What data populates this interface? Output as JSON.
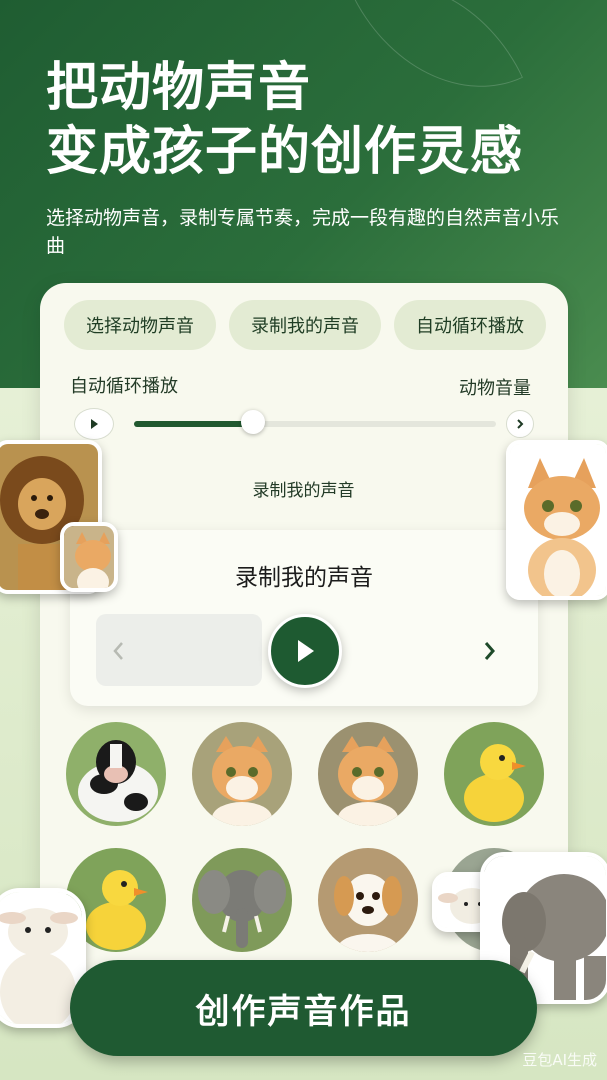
{
  "hero": {
    "title_line1": "把动物声音",
    "title_line2": "变成孩子的创作灵感",
    "subtitle": "选择动物声音，录制专属节奏，完成一段有趣的自然声音小乐曲"
  },
  "chips": [
    "选择动物声音",
    "录制我的声音",
    "自动循环播放"
  ],
  "controls": {
    "loop_label": "自动循环播放",
    "volume_label": "动物音量",
    "volume_level": 0.33,
    "record_caption": "录制我的声音"
  },
  "recorder": {
    "title": "录制我的声音",
    "play_icon": "play-icon",
    "prev_icon": "chevron-left-icon",
    "next_icon": "chevron-right-icon"
  },
  "animals": [
    "cow",
    "kitten",
    "kitten",
    "duckling",
    "duckling",
    "elephant",
    "puppy",
    "lamb"
  ],
  "stickers": [
    "lion",
    "kitten",
    "kitten",
    "lamb",
    "lamb",
    "elephant"
  ],
  "cta": {
    "label": "创作声音作品"
  },
  "watermark": "豆包AI生成",
  "colors": {
    "primary": "#1f5a32",
    "chip_bg": "#e3ebd3",
    "card_bg": "#f8f9ee"
  }
}
